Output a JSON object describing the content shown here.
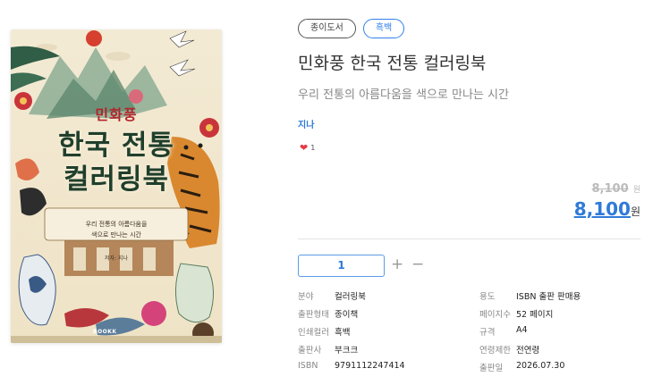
{
  "cover": {
    "subtitle_label": "민화풍",
    "title_line1": "한국 전통",
    "title_line2": "컬러링북",
    "description_line1": "우리 전통의 아름다움을",
    "description_line2": "색으로 만나는 시간",
    "author_line": "저자: 지나",
    "publisher_mark": "BOOKK"
  },
  "tags": [
    "종이도서",
    "흑백"
  ],
  "title": "민화풍 한국 전통 컬러링북",
  "subtitle": "우리 전통의 아름다움을 색으로 만나는 시간",
  "author": "지나",
  "likes": {
    "icon": "heart-icon",
    "count": "1"
  },
  "price": {
    "original": "8,100",
    "original_unit": "원",
    "sale": "8,100",
    "sale_unit": "원"
  },
  "quantity": {
    "value": "1",
    "plus": "+",
    "minus": "−"
  },
  "specs": [
    {
      "label": "분야",
      "value": "컬러링북",
      "label2": "용도",
      "value2": "ISBN 출판 판매용"
    },
    {
      "label": "출판형태",
      "value": "종이책",
      "label2": "페이지수",
      "value2": "52 페이지"
    },
    {
      "label": "인쇄컬러",
      "value": "흑백",
      "label2": "규격",
      "value2": "A4"
    },
    {
      "label": "출판사",
      "value": "부크크",
      "label2": "연령제한",
      "value2": "전연령"
    },
    {
      "label": "ISBN",
      "value": "9791112247414",
      "label2": "출판일",
      "value2": "2026.07.30"
    }
  ],
  "colors": {
    "accent": "#2f7ad9",
    "heart": "#e53945",
    "title_red": "#b3242a"
  }
}
